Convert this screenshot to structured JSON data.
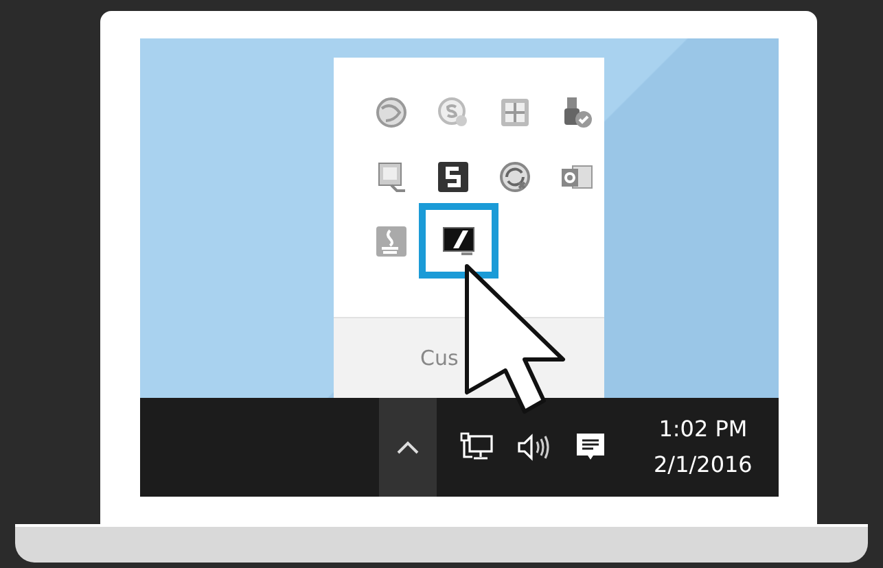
{
  "tray_overflow": {
    "icons": [
      {
        "kind": "globe",
        "selected": false
      },
      {
        "kind": "skype",
        "selected": false
      },
      {
        "kind": "shield",
        "selected": false
      },
      {
        "kind": "usb",
        "selected": false
      },
      {
        "kind": "remote",
        "selected": false
      },
      {
        "kind": "letter",
        "selected": false
      },
      {
        "kind": "sync",
        "selected": false
      },
      {
        "kind": "mail",
        "selected": false
      },
      {
        "kind": "cup",
        "selected": false
      },
      {
        "kind": "display",
        "selected": true
      }
    ],
    "customize_label": "Cus"
  },
  "taskbar": {
    "time": "1:02 PM",
    "date": "2/1/2016"
  }
}
